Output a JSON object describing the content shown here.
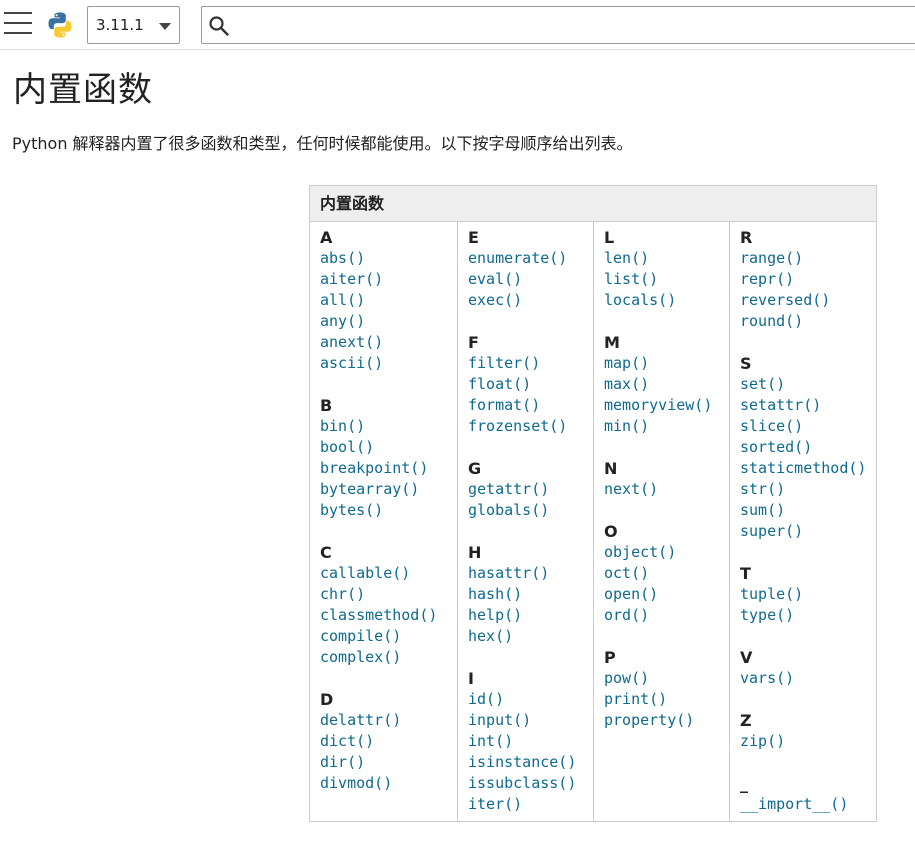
{
  "header": {
    "version": "3.11.1",
    "search": {
      "value": "",
      "placeholder": ""
    }
  },
  "page": {
    "title": "内置函数",
    "intro": "Python 解释器内置了很多函数和类型，任何时候都能使用。以下按字母顺序给出列表。"
  },
  "table": {
    "header": "内置函数",
    "columns": [
      [
        {
          "letter": "A",
          "items": [
            "abs()",
            "aiter()",
            "all()",
            "any()",
            "anext()",
            "ascii()"
          ]
        },
        {
          "letter": "B",
          "items": [
            "bin()",
            "bool()",
            "breakpoint()",
            "bytearray()",
            "bytes()"
          ]
        },
        {
          "letter": "C",
          "items": [
            "callable()",
            "chr()",
            "classmethod()",
            "compile()",
            "complex()"
          ]
        },
        {
          "letter": "D",
          "items": [
            "delattr()",
            "dict()",
            "dir()",
            "divmod()"
          ]
        }
      ],
      [
        {
          "letter": "E",
          "items": [
            "enumerate()",
            "eval()",
            "exec()"
          ]
        },
        {
          "letter": "F",
          "items": [
            "filter()",
            "float()",
            "format()",
            "frozenset()"
          ]
        },
        {
          "letter": "G",
          "items": [
            "getattr()",
            "globals()"
          ]
        },
        {
          "letter": "H",
          "items": [
            "hasattr()",
            "hash()",
            "help()",
            "hex()"
          ]
        },
        {
          "letter": "I",
          "items": [
            "id()",
            "input()",
            "int()",
            "isinstance()",
            "issubclass()",
            "iter()"
          ]
        }
      ],
      [
        {
          "letter": "L",
          "items": [
            "len()",
            "list()",
            "locals()"
          ]
        },
        {
          "letter": "M",
          "items": [
            "map()",
            "max()",
            "memoryview()",
            "min()"
          ]
        },
        {
          "letter": "N",
          "items": [
            "next()"
          ]
        },
        {
          "letter": "O",
          "items": [
            "object()",
            "oct()",
            "open()",
            "ord()"
          ]
        },
        {
          "letter": "P",
          "items": [
            "pow()",
            "print()",
            "property()"
          ]
        }
      ],
      [
        {
          "letter": "R",
          "items": [
            "range()",
            "repr()",
            "reversed()",
            "round()"
          ]
        },
        {
          "letter": "S",
          "items": [
            "set()",
            "setattr()",
            "slice()",
            "sorted()",
            "staticmethod()",
            "str()",
            "sum()",
            "super()"
          ]
        },
        {
          "letter": "T",
          "items": [
            "tuple()",
            "type()"
          ]
        },
        {
          "letter": "V",
          "items": [
            "vars()"
          ]
        },
        {
          "letter": "Z",
          "items": [
            "zip()"
          ]
        },
        {
          "letter": "_",
          "items": [
            "__import__()"
          ]
        }
      ]
    ]
  }
}
